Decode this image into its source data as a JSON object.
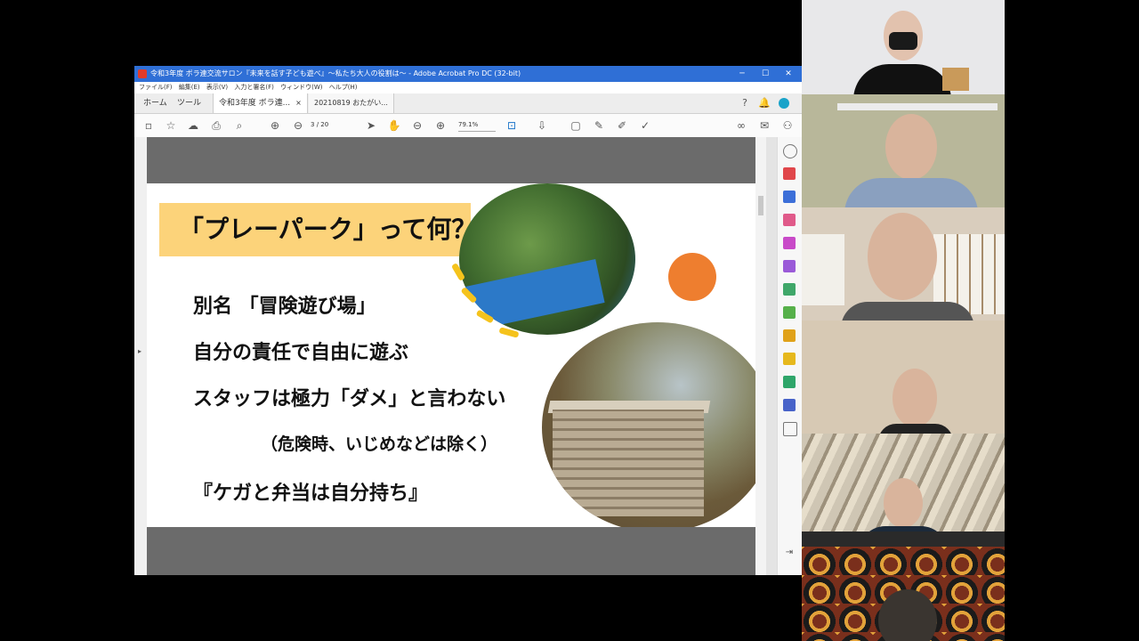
{
  "window": {
    "title": "令和3年度 ボラ連交流サロン『未来を話す子ども遊べ』～私たち大人の役割は～ - Adobe Acrobat Pro DC (32-bit)",
    "min_label": "─",
    "max_label": "☐",
    "close_label": "✕"
  },
  "menu": [
    "ファイル(F)",
    "編集(E)",
    "表示(V)",
    "入力と署名(F)",
    "ウィンドウ(W)",
    "ヘルプ(H)"
  ],
  "tabs": {
    "home": "ホーム",
    "tools": "ツール",
    "doc1": "令和3年度 ボラ連...",
    "doc1_close": "×",
    "doc2": "20210819 おたがい..."
  },
  "toolbar": {
    "page_current": "3",
    "page_sep": "/",
    "page_total": "20",
    "zoom": "79.1%"
  },
  "slide": {
    "heading": "「プレーパーク」って何？",
    "lines": [
      "別名 「冒険遊び場」",
      "自分の責任で自由に遊ぶ",
      "スタッフは極力「ダメ」と言わない",
      "（危険時、いじめなどは除く）",
      "『ケガと弁当は自分持ち』"
    ]
  },
  "colors": {
    "acrobat_blue": "#2f6fd6",
    "heading_band": "#fcd37a",
    "accent_orange": "#ee7e2f",
    "accent_yellow": "#f5c31c"
  },
  "icons": {
    "help": "question-icon",
    "bell": "bell-icon",
    "search": "zoom-icon"
  }
}
